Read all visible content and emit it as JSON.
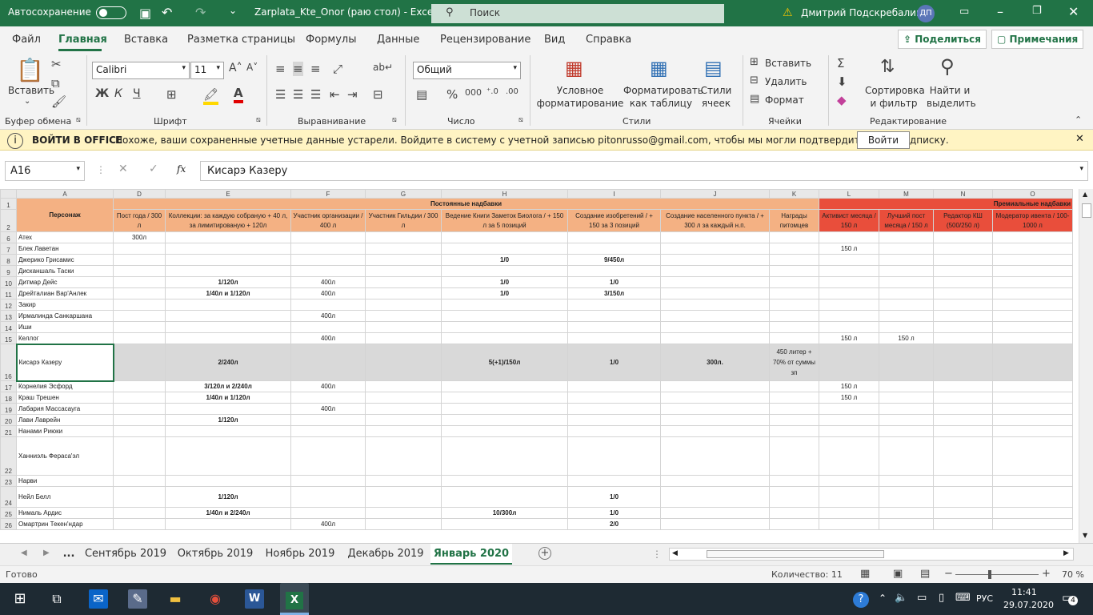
{
  "titlebar": {
    "autosave_label": "Автосохранение",
    "doc_title": "Zarplata_Kte_Onor (раю стол)  -  Excel",
    "search_placeholder": "Поиск",
    "user_name": "Дмитрий Подскребалин",
    "user_initials": "ДП"
  },
  "menu": {
    "tabs": [
      "Файл",
      "Главная",
      "Вставка",
      "Разметка страницы",
      "Формулы",
      "Данные",
      "Рецензирование",
      "Вид",
      "Справка"
    ],
    "share_label": "Поделиться",
    "notes_label": "Примечания"
  },
  "ribbon": {
    "clipboard": {
      "paste_label": "Вставить",
      "group_label": "Буфер обмена"
    },
    "font": {
      "font_name": "Calibri",
      "font_size": "11",
      "group_label": "Шрифт",
      "bold": "Ж",
      "italic": "К",
      "underline": "Ч"
    },
    "alignment": {
      "group_label": "Выравнивание"
    },
    "number": {
      "format": "Общий",
      "group_label": "Число"
    },
    "styles": {
      "conditional": "Условное форматирование",
      "as_table": "Форматировать как таблицу",
      "cell_styles": "Стили ячеек",
      "group_label": "Стили"
    },
    "cells": {
      "insert": "Вставить",
      "delete": "Удалить",
      "format": "Формат",
      "group_label": "Ячейки"
    },
    "editing": {
      "sort": "Сортировка и фильтр",
      "find": "Найти и выделить",
      "group_label": "Редактирование"
    }
  },
  "message_bar": {
    "title": "ВОЙТИ В OFFICE",
    "text": "Похоже, ваши сохраненные учетные данные устарели. Войдите в систему с учетной записью pitonrusso@gmail.com, чтобы мы могли подтвердить вашу подписку.",
    "button": "Войти"
  },
  "formula_bar": {
    "name_box": "A16",
    "fx": "fx",
    "content": "Кисарэ Казеру"
  },
  "sheet": {
    "columns": [
      "A",
      "D",
      "E",
      "F",
      "G",
      "H",
      "I",
      "J",
      "K",
      "L",
      "M",
      "N",
      "O"
    ],
    "group_permanent": "Постоянные надбавки",
    "group_premium": "Премиальные надбавки",
    "header_a": "Персонаж",
    "headers": [
      "Пост года / 300 л",
      "Коллекции: за каждую собраную + 40 л, за лимитированую + 120л",
      "Участник организации / 400 л",
      "Участник Гильдии / 300 л",
      "Ведение Книги Заметок Биолога / + 150 л за 5 позиций",
      "Создание изобретений / + 150 за 3 позиций",
      "Создание населенного пункта / + 300 л за каждый н.п.",
      "Награды питомцев",
      "Активист месяца / 150 л",
      "Лучший пост месяца / 150 л",
      "Редактор КШ (500/250 л)",
      "Модератор ивента / 100-1000 л"
    ],
    "rows": [
      {
        "n": "6",
        "name": "Атех",
        "c": [
          "300л",
          "",
          "",
          "",
          "",
          "",
          "",
          "",
          "",
          "",
          "",
          ""
        ]
      },
      {
        "n": "7",
        "name": "Блек Лаветан",
        "c": [
          "",
          "",
          "",
          "",
          "",
          "",
          "",
          "",
          "150 л",
          "",
          "",
          ""
        ]
      },
      {
        "n": "8",
        "name": "Джерико Грисамис",
        "c": [
          "",
          "",
          "",
          "",
          "1/0",
          "9/450л",
          "",
          "",
          "",
          "",
          "",
          ""
        ]
      },
      {
        "n": "9",
        "name": "Дисканшаль Таски",
        "c": [
          "",
          "",
          "",
          "",
          "",
          "",
          "",
          "",
          "",
          "",
          "",
          ""
        ]
      },
      {
        "n": "10",
        "name": "Дитмар Дейс",
        "c": [
          "",
          "1/120л",
          "400л",
          "",
          "1/0",
          "1/0",
          "",
          "",
          "",
          "",
          "",
          ""
        ]
      },
      {
        "n": "11",
        "name": "Дрейталиан Вар'Анлек",
        "c": [
          "",
          "1/40л  и  1/120л",
          "400л",
          "",
          "1/0",
          "3/150л",
          "",
          "",
          "",
          "",
          "",
          ""
        ]
      },
      {
        "n": "12",
        "name": "Закир",
        "c": [
          "",
          "",
          "",
          "",
          "",
          "",
          "",
          "",
          "",
          "",
          "",
          ""
        ]
      },
      {
        "n": "13",
        "name": "Ирмалинда Санкаршана",
        "c": [
          "",
          "",
          "400л",
          "",
          "",
          "",
          "",
          "",
          "",
          "",
          "",
          ""
        ]
      },
      {
        "n": "14",
        "name": "Иши",
        "c": [
          "",
          "",
          "",
          "",
          "",
          "",
          "",
          "",
          "",
          "",
          "",
          ""
        ]
      },
      {
        "n": "15",
        "name": "Келлог",
        "c": [
          "",
          "",
          "400л",
          "",
          "",
          "",
          "",
          "",
          "150 л",
          "150 л",
          "",
          ""
        ]
      },
      {
        "n": "16",
        "name": "Кисарэ Казеру",
        "c": [
          "",
          "2/240л",
          "",
          "",
          "5(+1)/150л",
          "1/0",
          "300л.",
          "450 литер + 70% от суммы зп",
          "",
          "",
          "",
          ""
        ]
      },
      {
        "n": "17",
        "name": "Корнелия Эсфорд",
        "c": [
          "",
          "3/120л и 2/240л",
          "400л",
          "",
          "",
          "",
          "",
          "",
          "150 л",
          "",
          "",
          ""
        ]
      },
      {
        "n": "18",
        "name": "Краш Трешен",
        "c": [
          "",
          "1/40л и 1/120л",
          "",
          "",
          "",
          "",
          "",
          "",
          "150 л",
          "",
          "",
          ""
        ]
      },
      {
        "n": "19",
        "name": "Лабария Массасауга",
        "c": [
          "",
          "",
          "400л",
          "",
          "",
          "",
          "",
          "",
          "",
          "",
          "",
          ""
        ]
      },
      {
        "n": "20",
        "name": "Лави Лаврейн",
        "c": [
          "",
          "1/120л",
          "",
          "",
          "",
          "",
          "",
          "",
          "",
          "",
          "",
          ""
        ]
      },
      {
        "n": "21",
        "name": "Нанами Риюки",
        "c": [
          "",
          "",
          "",
          "",
          "",
          "",
          "",
          "",
          "",
          "",
          "",
          ""
        ]
      },
      {
        "n": "22",
        "name": "Ханниэль Ферасa'эл",
        "c": [
          "",
          "",
          "",
          "",
          "",
          "",
          "",
          "",
          "",
          "",
          "",
          ""
        ]
      },
      {
        "n": "23",
        "name": "Нарви",
        "c": [
          "",
          "",
          "",
          "",
          "",
          "",
          "",
          "",
          "",
          "",
          "",
          ""
        ]
      },
      {
        "n": "24",
        "name": "Нейл Белл",
        "c": [
          "",
          "1/120л",
          "",
          "",
          "",
          "1/0",
          "",
          "",
          "",
          "",
          "",
          ""
        ]
      },
      {
        "n": "25",
        "name": "Нималь Ардис",
        "c": [
          "",
          "1/40л и 2/240л",
          "",
          "",
          "10/300л",
          "1/0",
          "",
          "",
          "",
          "",
          "",
          ""
        ]
      },
      {
        "n": "26",
        "name": "Омартрин Текен'ндар",
        "c": [
          "",
          "",
          "400л",
          "",
          "",
          "2/0",
          "",
          "",
          "",
          "",
          "",
          ""
        ]
      }
    ]
  },
  "sheet_tabs": [
    "...",
    "Сентябрь 2019",
    "Октябрь 2019",
    "Ноябрь 2019",
    "Декабрь 2019",
    "Январь 2020"
  ],
  "status": {
    "ready": "Готово",
    "count": "Количество: 11",
    "zoom": "70 %"
  },
  "taskbar": {
    "lang": "РУС",
    "time": "11:41",
    "date": "29.07.2020",
    "notif_count": "4"
  }
}
